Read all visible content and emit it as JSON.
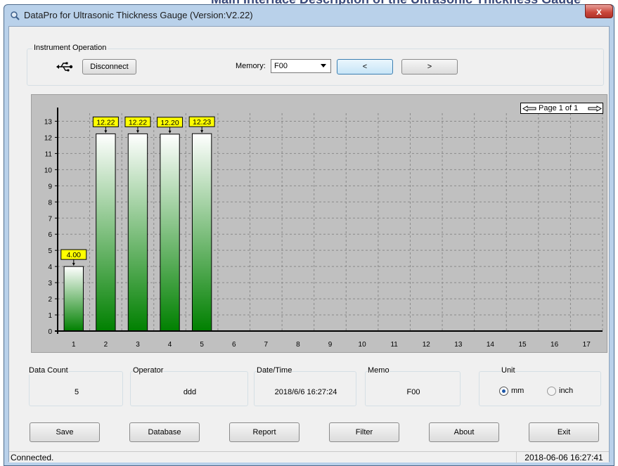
{
  "page_header_fragment": "Main Interface Description of the Ultrasonic Thickness Gauge",
  "window": {
    "title": "DataPro for Ultrasonic Thickness Gauge (Version:V2.22)",
    "close_glyph": "x"
  },
  "instrument": {
    "group_title": "Instrument Operation",
    "usb_icon": "usb-icon",
    "disconnect_label": "Disconnect",
    "memory_label": "Memory:",
    "memory_value": "F00",
    "prev_label": "<",
    "next_label": ">"
  },
  "pager": {
    "text": "Page 1 of 1"
  },
  "chart_data": {
    "type": "bar",
    "categories": [
      "1",
      "2",
      "3",
      "4",
      "5"
    ],
    "values": [
      4.0,
      12.22,
      12.22,
      12.2,
      12.23
    ],
    "data_labels": [
      "4.00",
      "12.22",
      "12.22",
      "12.20",
      "12.23"
    ],
    "x_ticks": [
      "1",
      "2",
      "3",
      "4",
      "5",
      "6",
      "7",
      "8",
      "9",
      "10",
      "11",
      "12",
      "13",
      "14",
      "15",
      "16",
      "17"
    ],
    "y_ticks": [
      "0",
      "1",
      "2",
      "3",
      "4",
      "5",
      "6",
      "7",
      "8",
      "9",
      "10",
      "11",
      "12",
      "13"
    ],
    "ylim": [
      0,
      13.5
    ],
    "grid": true,
    "colors": {
      "bar_top": "#ffffff",
      "bar_bottom": "#008000",
      "label_bg": "#ffff00",
      "plot_bg": "#c0c0c0"
    }
  },
  "info": {
    "data_count_label": "Data Count",
    "data_count_value": "5",
    "operator_label": "Operator",
    "operator_value": "ddd",
    "datetime_label": "Date/Time",
    "datetime_value": "2018/6/6 16:27:24",
    "memo_label": "Memo",
    "memo_value": "F00",
    "unit_label": "Unit",
    "unit_mm": "mm",
    "unit_inch": "inch"
  },
  "buttons": {
    "save": "Save",
    "database": "Database",
    "report": "Report",
    "filter": "Filter",
    "about": "About",
    "exit": "Exit"
  },
  "status": {
    "left": "Connected.",
    "right": "2018-06-06 16:27:41"
  }
}
